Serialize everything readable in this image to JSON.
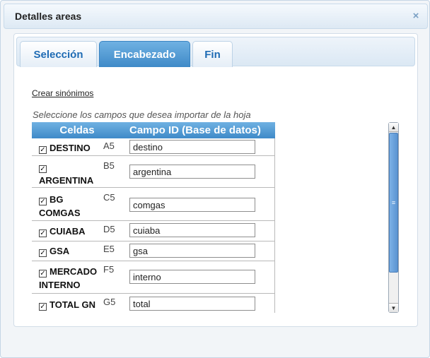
{
  "dialog": {
    "title": "Detalles areas",
    "close_glyph": "×"
  },
  "tabs": [
    {
      "label": "Selección",
      "active": false
    },
    {
      "label": "Encabezado",
      "active": true
    },
    {
      "label": "Fin",
      "active": false
    }
  ],
  "link_synonyms": "Crear sinónimos",
  "instructions": "Seleccione los campos que desea importar de la hoja",
  "table": {
    "headers": {
      "cells": "Celdas",
      "field": "Campo ID (Base de datos)"
    },
    "rows": [
      {
        "name": "DESTINO",
        "ref": "A5",
        "value": "destino",
        "checked": true
      },
      {
        "name": "ARGENTINA",
        "ref": "B5",
        "value": "argentina",
        "checked": true
      },
      {
        "name": "BG COMGAS",
        "ref": "C5",
        "value": "comgas",
        "checked": true
      },
      {
        "name": "CUIABA",
        "ref": "D5",
        "value": "cuiaba",
        "checked": true
      },
      {
        "name": "GSA",
        "ref": "E5",
        "value": "gsa",
        "checked": true
      },
      {
        "name": "MERCADO INTERNO",
        "ref": "F5",
        "value": "interno",
        "checked": true
      },
      {
        "name": "TOTAL GN",
        "ref": "G5",
        "value": "total",
        "checked": true
      }
    ]
  },
  "scrollbar": {
    "up_glyph": "▲",
    "down_glyph": "▼",
    "thumb_grip": "≡"
  },
  "colors": {
    "accent": "#3f8ac8",
    "tab_text": "#1e6bb4"
  }
}
